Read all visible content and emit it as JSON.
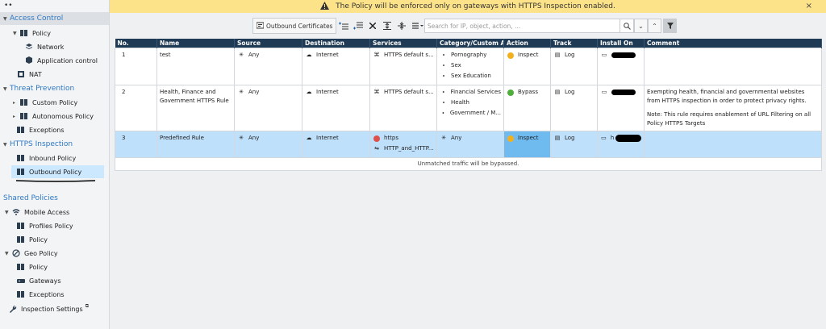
{
  "banner": {
    "message": "The Policy will be enforced only on gateways with HTTPS Inspection enabled.",
    "close": "×"
  },
  "sidebar": {
    "items": [
      {
        "label": "Access Control",
        "type": "section"
      },
      {
        "label": "Policy"
      },
      {
        "label": "Network"
      },
      {
        "label": "Application control"
      },
      {
        "label": "NAT"
      },
      {
        "label": "Threat Prevention",
        "type": "section"
      },
      {
        "label": "Custom Policy"
      },
      {
        "label": "Autonomous Policy"
      },
      {
        "label": "Exceptions"
      },
      {
        "label": "HTTPS Inspection",
        "type": "section"
      },
      {
        "label": "Inbound Policy"
      },
      {
        "label": "Outbound Policy"
      },
      {
        "label": "Shared Policies",
        "type": "section"
      },
      {
        "label": "Mobile Access"
      },
      {
        "label": "Profiles Policy"
      },
      {
        "label": "Policy"
      },
      {
        "label": "Geo Policy"
      },
      {
        "label": "Policy"
      },
      {
        "label": "Gateways"
      },
      {
        "label": "Exceptions"
      },
      {
        "label": "Inspection Settings"
      }
    ]
  },
  "toolbar": {
    "outbound_certificates": "Outbound Certificates"
  },
  "search": {
    "placeholder": "Search for IP, object, action, ..."
  },
  "table": {
    "headers": [
      "No.",
      "Name",
      "Source",
      "Destination",
      "Services",
      "Category/Custom A...",
      "Action",
      "Track",
      "Install On",
      "Comment"
    ],
    "rows": [
      {
        "no": "1",
        "name": "test",
        "source": "Any",
        "destination": "Internet",
        "services": [
          "HTTPS default s..."
        ],
        "categories": [
          "Pornography",
          "Sex",
          "Sex Education"
        ],
        "action": "Inspect",
        "track": "Log",
        "install_on": "",
        "comment": ""
      },
      {
        "no": "2",
        "name": "Health, Finance and Government HTTPS Rule",
        "source": "Any",
        "destination": "Internet",
        "services": [
          "HTTPS default s..."
        ],
        "categories": [
          "Financial Services",
          "Health",
          "Government / M..."
        ],
        "action": "Bypass",
        "track": "Log",
        "install_on": "",
        "comment": "Exempting health, financial and governmental websites from HTTPS inspection in order to protect privacy rights.",
        "comment2": "Note: This rule requires enablement of URL Filtering on all Policy HTTPS Targets"
      },
      {
        "no": "3",
        "name": "Predefined Rule",
        "source": "Any",
        "destination": "Internet",
        "services": [
          "https",
          "HTTP_and_HTTP..."
        ],
        "categories": [
          "Any"
        ],
        "action": "Inspect",
        "track": "Log",
        "install_on": "h",
        "comment": ""
      }
    ],
    "footer": "Unmatched traffic will be bypassed."
  },
  "colors": {
    "header_bg": "#1f3a55",
    "selected_row": "#bfe0fb",
    "banner": "#fce38a",
    "section": "#2e78c2"
  }
}
